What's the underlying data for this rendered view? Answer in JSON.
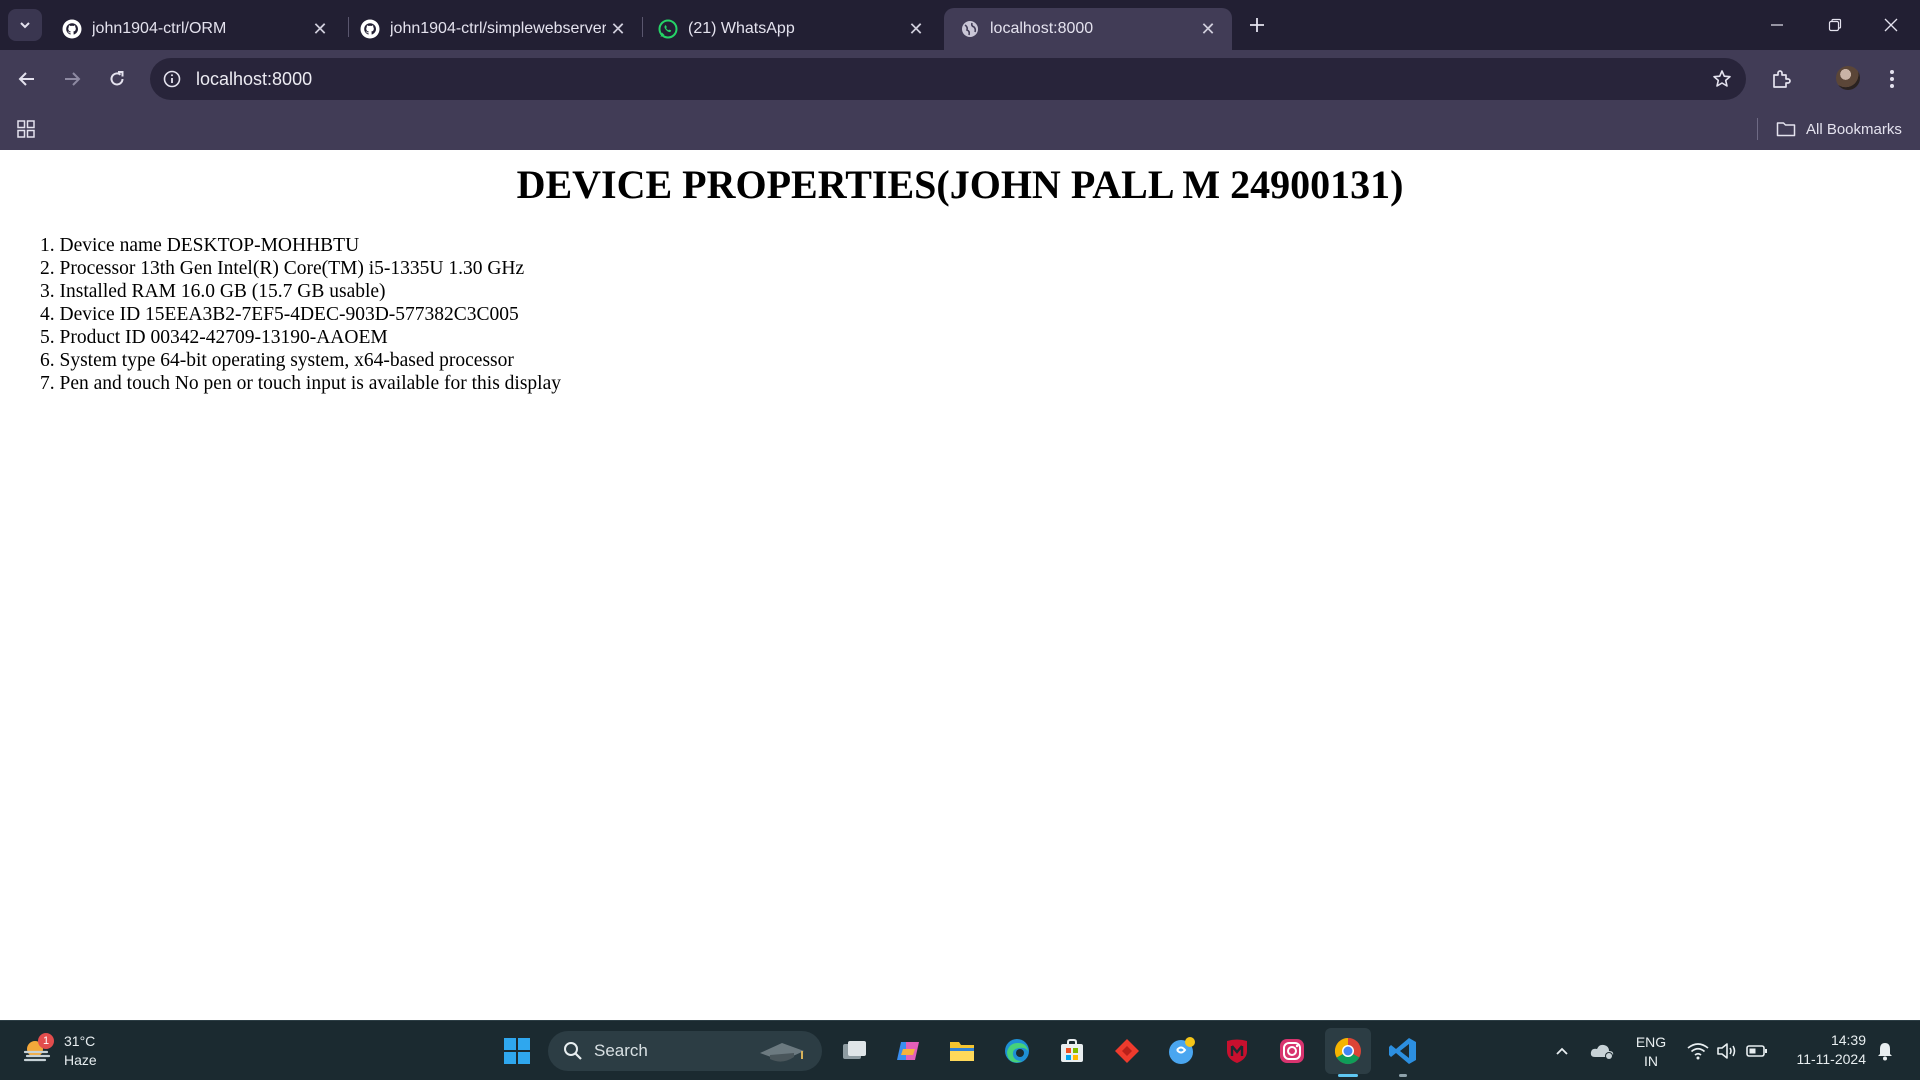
{
  "browser": {
    "tabs": [
      {
        "title": "john1904-ctrl/ORM",
        "favicon": "github-icon",
        "active": false
      },
      {
        "title": "john1904-ctrl/simplewebserver",
        "favicon": "github-icon",
        "active": false
      },
      {
        "title": "(21) WhatsApp",
        "favicon": "whatsapp-icon",
        "active": false
      },
      {
        "title": "localhost:8000",
        "favicon": "globe-icon",
        "active": true
      }
    ],
    "address": "localhost:8000",
    "bookmarks_label": "All Bookmarks"
  },
  "page": {
    "title": "DEVICE PROPERTIES(JOHN PALL M 24900131)",
    "properties": [
      "1. Device name DESKTOP-MOHHBTU",
      "2. Processor 13th Gen Intel(R) Core(TM) i5-1335U 1.30 GHz",
      "3. Installed RAM 16.0 GB (15.7 GB usable)",
      "4. Device ID 15EEA3B2-7EF5-4DEC-903D-577382C3C005",
      "5. Product ID 00342-42709-13190-AAOEM",
      "6. System type 64-bit operating system, x64-based processor",
      "7. Pen and touch No pen or touch input is available for this display"
    ]
  },
  "taskbar": {
    "weather": {
      "temperature": "31°C",
      "condition": "Haze",
      "badge": "1"
    },
    "search_label": "Search",
    "apps": [
      "windows-start",
      "task-view",
      "copilot",
      "file-explorer",
      "edge",
      "microsoft-store",
      "anydesk",
      "chatgpt",
      "mcafee",
      "instagram",
      "chrome",
      "vscode"
    ],
    "language": {
      "line1": "ENG",
      "line2": "IN"
    },
    "clock": {
      "time": "14:39",
      "date": "11-11-2024"
    }
  },
  "colors": {
    "tabstrip_bg": "#221f33",
    "toolbar_bg": "#413c56",
    "omnibox_bg": "#28243a",
    "taskbar_bg": "#1b2a30",
    "page_bg": "#ffffff"
  }
}
